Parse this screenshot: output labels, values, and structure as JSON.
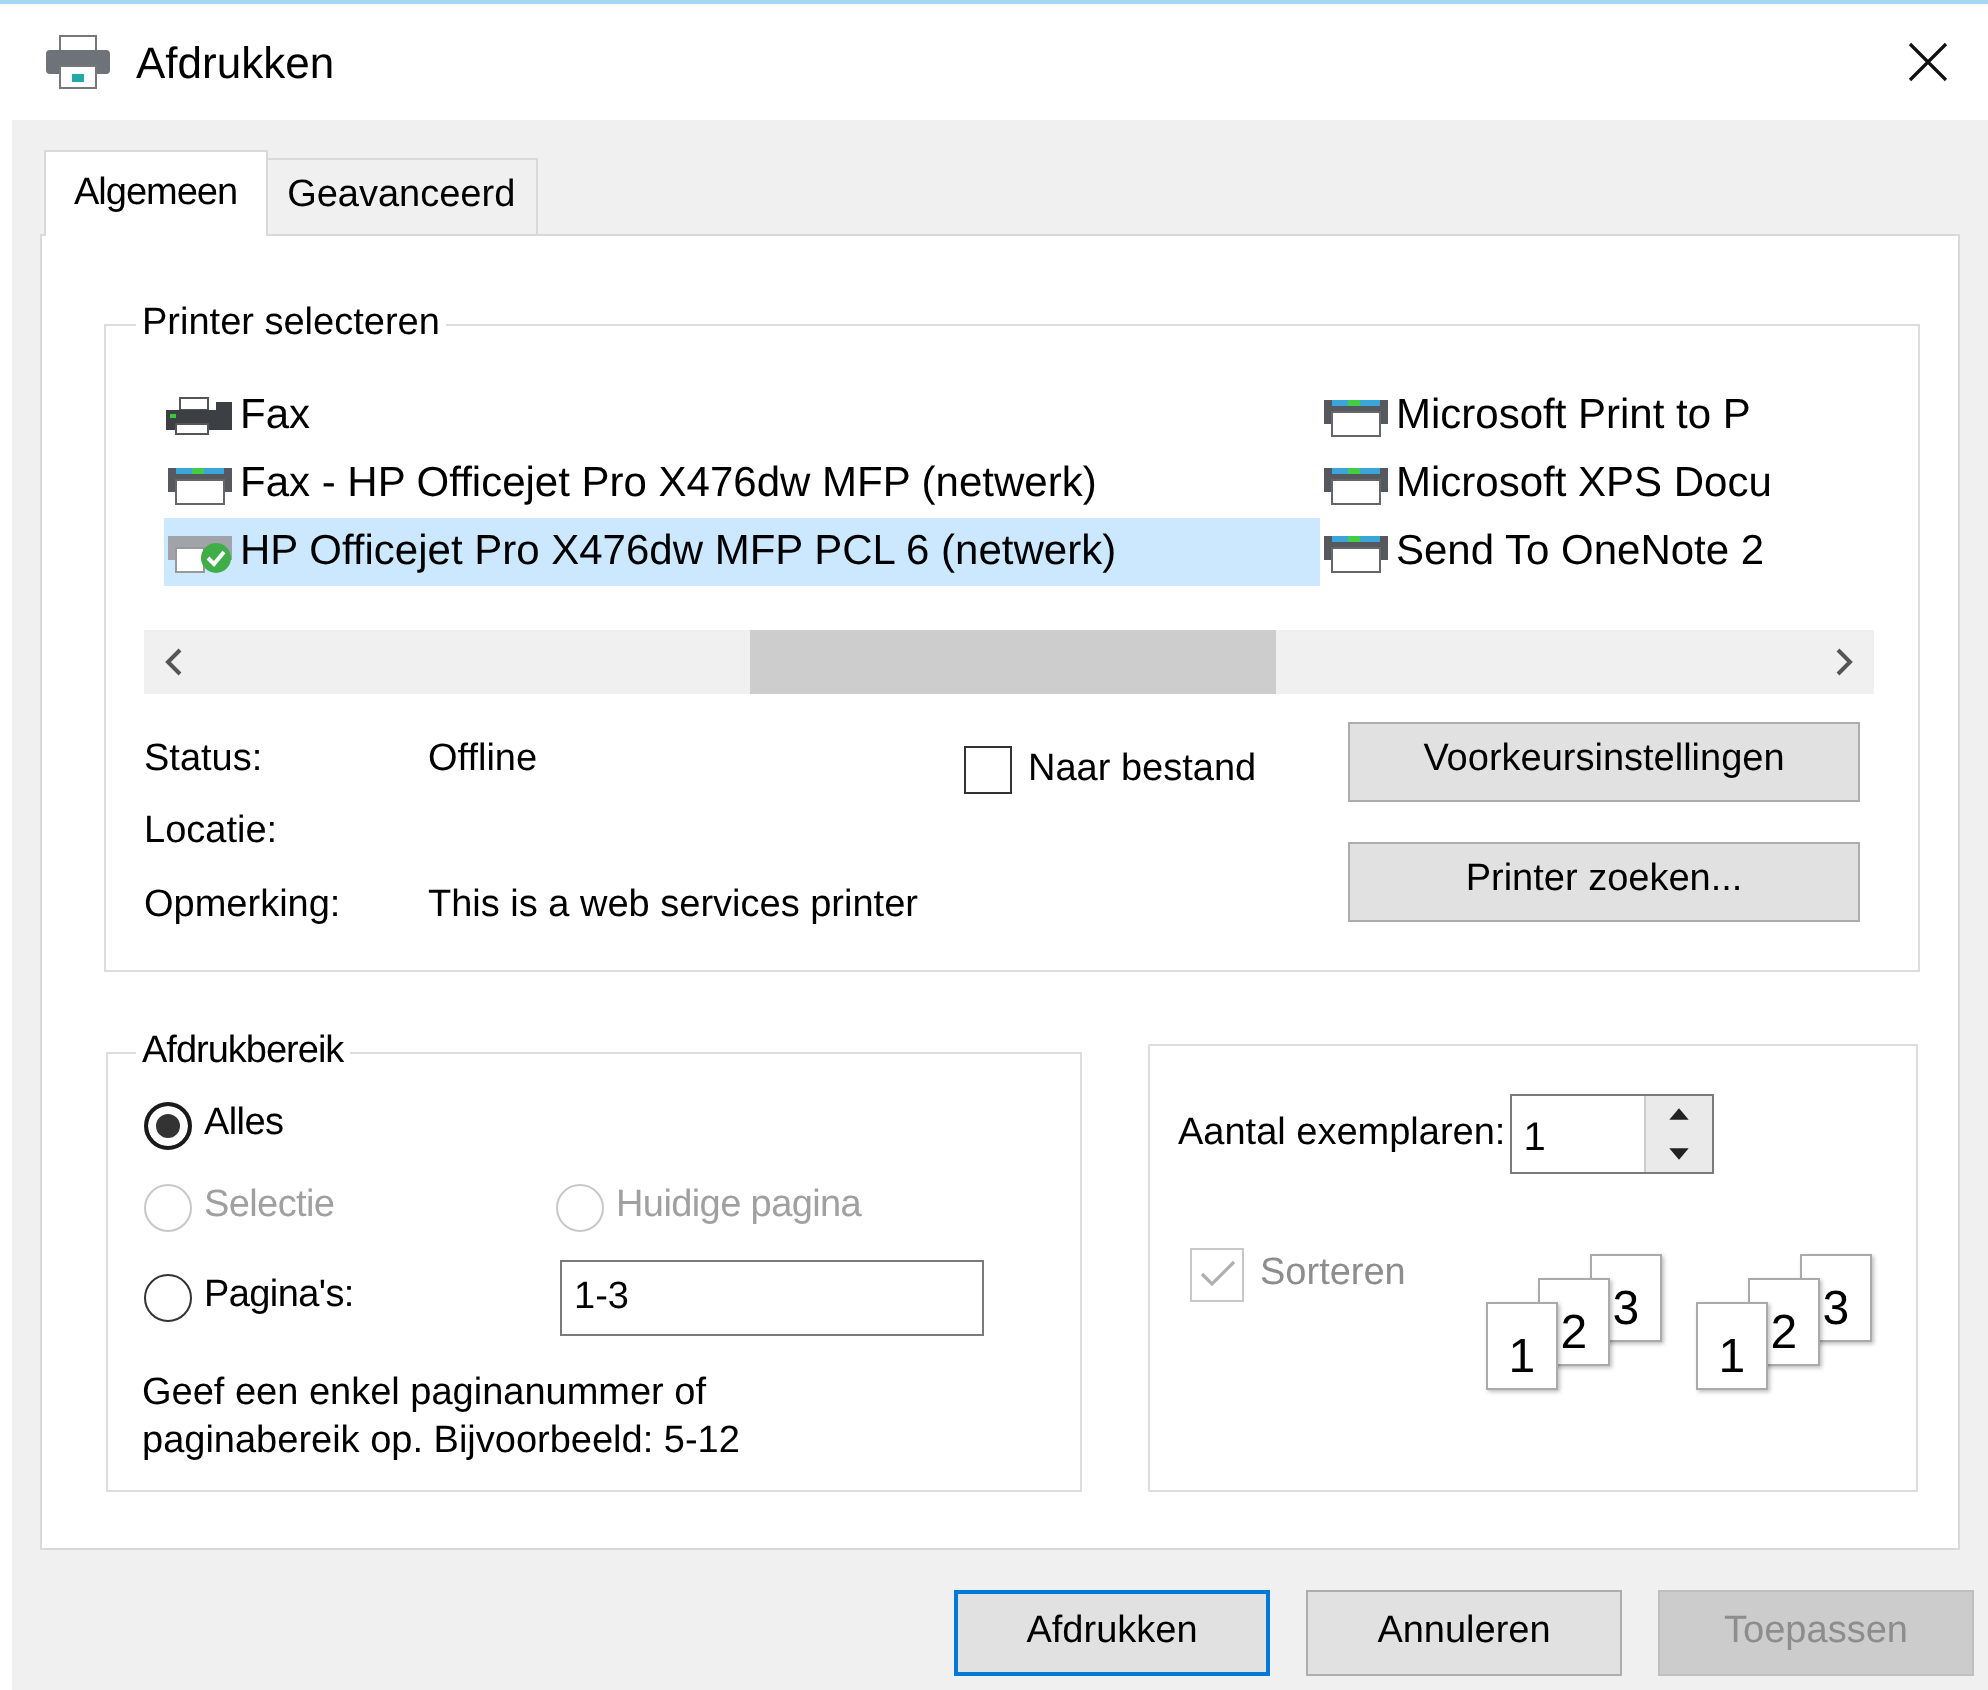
{
  "window": {
    "title": "Afdrukken"
  },
  "tabs": [
    {
      "label": "Algemeen",
      "selected": true
    },
    {
      "label": "Geavanceerd",
      "selected": false
    }
  ],
  "printer_group": {
    "legend": "Printer selecteren",
    "printers": [
      {
        "name": "Fax",
        "kind": "fax",
        "selected": false
      },
      {
        "name": "Fax - HP Officejet Pro X476dw MFP (netwerk)",
        "kind": "printer",
        "selected": false
      },
      {
        "name": "HP Officejet Pro X476dw MFP PCL 6 (netwerk)",
        "kind": "default_printer",
        "selected": true
      },
      {
        "name": "Microsoft Print to P",
        "kind": "printer",
        "selected": false
      },
      {
        "name": "Microsoft XPS Docu",
        "kind": "printer",
        "selected": false
      },
      {
        "name": "Send To OneNote 2",
        "kind": "printer",
        "selected": false
      }
    ],
    "details": [
      {
        "label": "Status:",
        "value": "Offline"
      },
      {
        "label": "Locatie:"
      },
      {
        "label": "Opmerking:",
        "value": "This is a web services printer"
      }
    ],
    "to_file": {
      "label": "Naar bestand",
      "checked": false
    },
    "buttons": [
      "Voorkeursinstellingen",
      "Printer zoeken..."
    ]
  },
  "range_group": {
    "legend": "Afdrukbereik",
    "options": [
      {
        "label": "Alles",
        "selected": true,
        "disabled": false
      },
      {
        "label": "Selectie",
        "selected": false,
        "disabled": true
      },
      {
        "label": "Huidige pagina",
        "selected": false,
        "disabled": true
      },
      {
        "label": "Pagina's:",
        "selected": false,
        "disabled": false
      }
    ],
    "pages_value": "1-3",
    "hint": "Geef een enkel paginanummer of paginabereik op. Bijvoorbeeld: 5-12"
  },
  "copies_group": {
    "label": "Aantal exemplaren:",
    "value": "1",
    "collate": {
      "label": "Sorteren",
      "checked": true,
      "disabled": true
    },
    "collate_icons": [
      {
        "pages": [
          "1",
          "2",
          "3"
        ]
      },
      {
        "pages": [
          "1",
          "2",
          "3"
        ]
      }
    ]
  },
  "buttons": [
    {
      "label": "Afdrukken",
      "kind": "default"
    },
    {
      "label": "Annuleren",
      "kind": "normal"
    },
    {
      "label": "Toepassen",
      "kind": "disabled"
    }
  ]
}
